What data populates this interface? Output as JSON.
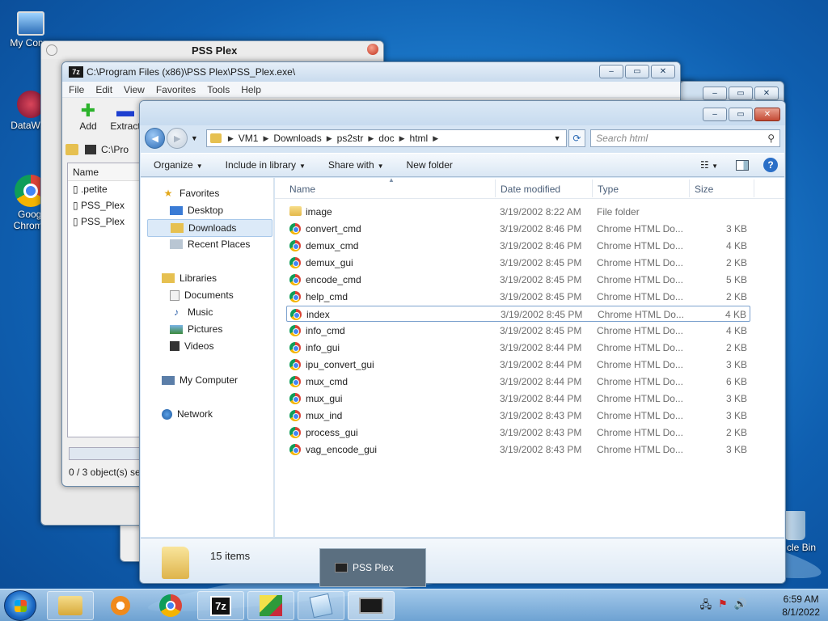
{
  "desktop": {
    "icons": [
      {
        "label": "My Comp",
        "icon": "computer-icon"
      },
      {
        "label": "DataWag",
        "icon": "datawag-icon"
      },
      {
        "label": "Googl Chrome",
        "icon": "chrome-icon"
      },
      {
        "label": "cle Bin",
        "icon": "recycle-bin-icon"
      }
    ]
  },
  "pss_window": {
    "title": "PSS Plex"
  },
  "zip_window": {
    "title": "C:\\Program Files (x86)\\PSS Plex\\PSS_Plex.exe\\",
    "menu": [
      "File",
      "Edit",
      "View",
      "Favorites",
      "Tools",
      "Help"
    ],
    "tools": [
      {
        "label": "Add",
        "glyph": "✚"
      },
      {
        "label": "Extract",
        "glyph": "▬"
      }
    ],
    "address": "C:\\Pro",
    "list_header": "Name",
    "files": [
      ".petite",
      "PSS_Plex",
      "PSS_Plex"
    ],
    "status": "0 / 3 object(s) se"
  },
  "explorer": {
    "breadcrumb": [
      "VM1",
      "Downloads",
      "ps2str",
      "doc",
      "html"
    ],
    "search_placeholder": "Search html",
    "commands": [
      {
        "label": "Organize",
        "dropdown": true
      },
      {
        "label": "Include in library",
        "dropdown": true
      },
      {
        "label": "Share with",
        "dropdown": true
      },
      {
        "label": "New folder",
        "dropdown": false
      }
    ],
    "nav": {
      "favorites": "Favorites",
      "favorites_items": [
        "Desktop",
        "Downloads",
        "Recent Places"
      ],
      "selected": "Downloads",
      "libraries": "Libraries",
      "libraries_items": [
        "Documents",
        "Music",
        "Pictures",
        "Videos"
      ],
      "computer": "My Computer",
      "network": "Network"
    },
    "columns": [
      "Name",
      "Date modified",
      "Type",
      "Size"
    ],
    "files": [
      {
        "name": "image",
        "date": "3/19/2002 8:22 AM",
        "type": "File folder",
        "size": "",
        "icon": "folder-icon"
      },
      {
        "name": "convert_cmd",
        "date": "3/19/2002 8:46 PM",
        "type": "Chrome HTML Do...",
        "size": "3 KB",
        "icon": "chrome-icon"
      },
      {
        "name": "demux_cmd",
        "date": "3/19/2002 8:46 PM",
        "type": "Chrome HTML Do...",
        "size": "4 KB",
        "icon": "chrome-icon"
      },
      {
        "name": "demux_gui",
        "date": "3/19/2002 8:45 PM",
        "type": "Chrome HTML Do...",
        "size": "2 KB",
        "icon": "chrome-icon"
      },
      {
        "name": "encode_cmd",
        "date": "3/19/2002 8:45 PM",
        "type": "Chrome HTML Do...",
        "size": "5 KB",
        "icon": "chrome-icon"
      },
      {
        "name": "help_cmd",
        "date": "3/19/2002 8:45 PM",
        "type": "Chrome HTML Do...",
        "size": "2 KB",
        "icon": "chrome-icon"
      },
      {
        "name": "index",
        "date": "3/19/2002 8:45 PM",
        "type": "Chrome HTML Do...",
        "size": "4 KB",
        "icon": "chrome-icon"
      },
      {
        "name": "info_cmd",
        "date": "3/19/2002 8:45 PM",
        "type": "Chrome HTML Do...",
        "size": "4 KB",
        "icon": "chrome-icon"
      },
      {
        "name": "info_gui",
        "date": "3/19/2002 8:44 PM",
        "type": "Chrome HTML Do...",
        "size": "2 KB",
        "icon": "chrome-icon"
      },
      {
        "name": "ipu_convert_gui",
        "date": "3/19/2002 8:44 PM",
        "type": "Chrome HTML Do...",
        "size": "3 KB",
        "icon": "chrome-icon"
      },
      {
        "name": "mux_cmd",
        "date": "3/19/2002 8:44 PM",
        "type": "Chrome HTML Do...",
        "size": "6 KB",
        "icon": "chrome-icon"
      },
      {
        "name": "mux_gui",
        "date": "3/19/2002 8:44 PM",
        "type": "Chrome HTML Do...",
        "size": "3 KB",
        "icon": "chrome-icon"
      },
      {
        "name": "mux_ind",
        "date": "3/19/2002 8:43 PM",
        "type": "Chrome HTML Do...",
        "size": "3 KB",
        "icon": "chrome-icon"
      },
      {
        "name": "process_gui",
        "date": "3/19/2002 8:43 PM",
        "type": "Chrome HTML Do...",
        "size": "2 KB",
        "icon": "chrome-icon"
      },
      {
        "name": "vag_encode_gui",
        "date": "3/19/2002 8:43 PM",
        "type": "Chrome HTML Do...",
        "size": "3 KB",
        "icon": "chrome-icon"
      }
    ],
    "selected_file": "index",
    "item_count": "15 items"
  },
  "taskbar": {
    "popup_label": "PSS Plex",
    "time": "6:59 AM",
    "date": "8/1/2022",
    "apps": [
      "explorer-icon",
      "media-player-icon",
      "chrome-icon",
      "7zip-icon",
      "datawag-icon",
      "notepad-icon",
      "pss-plex-icon"
    ]
  }
}
